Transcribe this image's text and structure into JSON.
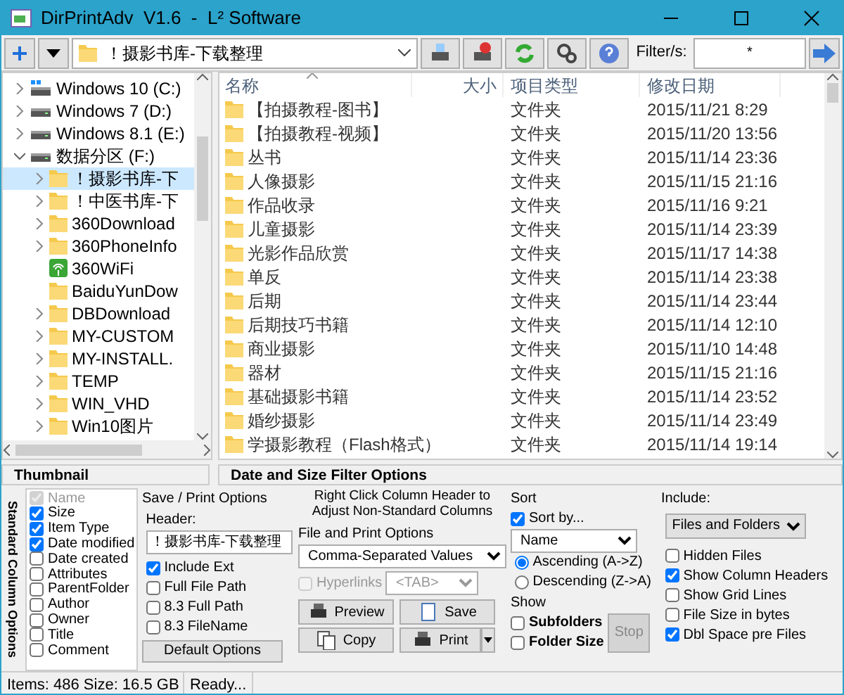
{
  "window": {
    "title": "DirPrintAdv  V1.6  -  L² Software"
  },
  "toolbar": {
    "path": "！摄影书库-下载整理",
    "filter_label": "Filter/s:",
    "filter_value": "*"
  },
  "tree": [
    {
      "label": "Windows 10 (C:)",
      "kind": "system-drive",
      "expanded": false,
      "selected": false
    },
    {
      "label": "Windows 7 (D:)",
      "kind": "drive",
      "expanded": false,
      "selected": false
    },
    {
      "label": "Windows 8.1 (E:)",
      "kind": "drive",
      "expanded": false,
      "selected": false
    },
    {
      "label": "数据分区 (F:)",
      "kind": "drive",
      "expanded": true,
      "selected": false,
      "children": [
        {
          "label": "！摄影书库-下",
          "kind": "folder",
          "expanded": false,
          "selected": true
        },
        {
          "label": "！中医书库-下",
          "kind": "folder",
          "expanded": false,
          "selected": false
        },
        {
          "label": "360Download",
          "kind": "folder",
          "expanded": false,
          "selected": false
        },
        {
          "label": "360PhoneInfo",
          "kind": "folder",
          "expanded": false,
          "selected": false
        },
        {
          "label": "360WiFi",
          "kind": "app",
          "expanded": false,
          "selected": false
        },
        {
          "label": "BaiduYunDow",
          "kind": "leaf",
          "expanded": false,
          "selected": false
        },
        {
          "label": "DBDownload",
          "kind": "folder",
          "expanded": false,
          "selected": false
        },
        {
          "label": "MY-CUSTOM",
          "kind": "folder",
          "expanded": false,
          "selected": false
        },
        {
          "label": "MY-INSTALL.",
          "kind": "folder",
          "expanded": false,
          "selected": false
        },
        {
          "label": "TEMP",
          "kind": "folder",
          "expanded": false,
          "selected": false
        },
        {
          "label": "WIN_VHD",
          "kind": "folder",
          "expanded": false,
          "selected": false
        },
        {
          "label": "Win10图片",
          "kind": "folder",
          "expanded": false,
          "selected": false
        }
      ]
    }
  ],
  "file_list": {
    "columns": [
      {
        "label": "名称",
        "sorted": true
      },
      {
        "label": "大小",
        "sorted": false
      },
      {
        "label": "项目类型",
        "sorted": false
      },
      {
        "label": "修改日期",
        "sorted": false
      }
    ],
    "rows": [
      {
        "name": "【拍摄教程-图书】",
        "type": "文件夹",
        "modified": "2015/11/21 8:29"
      },
      {
        "name": "【拍摄教程-视频】",
        "type": "文件夹",
        "modified": "2015/11/20 13:56"
      },
      {
        "name": "丛书",
        "type": "文件夹",
        "modified": "2015/11/14 23:36"
      },
      {
        "name": "人像摄影",
        "type": "文件夹",
        "modified": "2015/11/15 21:16"
      },
      {
        "name": "作品收录",
        "type": "文件夹",
        "modified": "2015/11/16 9:21"
      },
      {
        "name": "儿童摄影",
        "type": "文件夹",
        "modified": "2015/11/14 23:39"
      },
      {
        "name": "光影作品欣赏",
        "type": "文件夹",
        "modified": "2015/11/17 14:38"
      },
      {
        "name": "单反",
        "type": "文件夹",
        "modified": "2015/11/14 23:38"
      },
      {
        "name": "后期",
        "type": "文件夹",
        "modified": "2015/11/14 23:44"
      },
      {
        "name": "后期技巧书籍",
        "type": "文件夹",
        "modified": "2015/11/14 12:10"
      },
      {
        "name": "商业摄影",
        "type": "文件夹",
        "modified": "2015/11/10 14:48"
      },
      {
        "name": "器材",
        "type": "文件夹",
        "modified": "2015/11/15 21:16"
      },
      {
        "name": "基础摄影书籍",
        "type": "文件夹",
        "modified": "2015/11/14 23:52"
      },
      {
        "name": "婚纱摄影",
        "type": "文件夹",
        "modified": "2015/11/14 23:49"
      },
      {
        "name": "学摄影教程（Flash格式）",
        "type": "文件夹",
        "modified": "2015/11/14 19:14"
      }
    ]
  },
  "panel_headers": [
    "Thumbnail",
    "Date and Size Filter Options"
  ],
  "column_options": {
    "title": "Standard Column Options",
    "items": [
      {
        "label": "Name",
        "checked": true,
        "disabled": true
      },
      {
        "label": "Size",
        "checked": true,
        "disabled": false
      },
      {
        "label": "Item Type",
        "checked": true,
        "disabled": false
      },
      {
        "label": "Date modified",
        "checked": true,
        "disabled": false
      },
      {
        "label": "Date created",
        "checked": false,
        "disabled": false
      },
      {
        "label": "Attributes",
        "checked": false,
        "disabled": false
      },
      {
        "label": "ParentFolder",
        "checked": false,
        "disabled": false
      },
      {
        "label": "Author",
        "checked": false,
        "disabled": false
      },
      {
        "label": "Owner",
        "checked": false,
        "disabled": false
      },
      {
        "label": "Title",
        "checked": false,
        "disabled": false
      },
      {
        "label": "Comment",
        "checked": false,
        "disabled": false
      }
    ]
  },
  "save_print": {
    "title": "Save / Print Options",
    "header_label": "Header:",
    "header_value": "！摄影书库-下载整理",
    "options": [
      {
        "label": "Include Ext",
        "checked": true
      },
      {
        "label": "Full File Path",
        "checked": false
      },
      {
        "label": "8.3 Full Path",
        "checked": false
      },
      {
        "label": "8.3 FileName",
        "checked": false
      }
    ],
    "default_button": "Default Options"
  },
  "file_print": {
    "note": "Right Click Column Header to Adjust Non-Standard Columns",
    "title": "File and Print Options",
    "format": "Comma-Separated Values",
    "hyperlinks": {
      "label": "Hyperlinks",
      "checked": false,
      "disabled": true
    },
    "delimiter": "<TAB>",
    "buttons": [
      {
        "label": "Preview",
        "kind": "preview"
      },
      {
        "label": "Save",
        "kind": "save"
      },
      {
        "label": "Copy",
        "kind": "copy"
      },
      {
        "label": "Print",
        "kind": "print"
      }
    ]
  },
  "sort": {
    "title": "Sort",
    "sort_by": {
      "label": "Sort by...",
      "checked": true
    },
    "field": "Name",
    "orders": [
      {
        "label": "Ascending (A->Z)",
        "selected": true
      },
      {
        "label": "Descending (Z->A)",
        "selected": false
      }
    ]
  },
  "show": {
    "title": "Show",
    "options": [
      {
        "label": "Subfolders",
        "checked": false
      },
      {
        "label": "Folder Size",
        "checked": false
      }
    ],
    "stop_button": {
      "label": "Stop",
      "disabled": true
    }
  },
  "include": {
    "title": "Include:",
    "mode": "Files and Folders",
    "options": [
      {
        "label": "Hidden Files",
        "checked": false
      },
      {
        "label": "Show Column Headers",
        "checked": true
      },
      {
        "label": "Show Grid Lines",
        "checked": false
      },
      {
        "label": "File Size in bytes",
        "checked": false
      },
      {
        "label": "Dbl Space pre Files",
        "checked": true
      }
    ]
  },
  "status_bar": [
    "Items: 486 Size: 16.5 GB",
    "Ready..."
  ]
}
